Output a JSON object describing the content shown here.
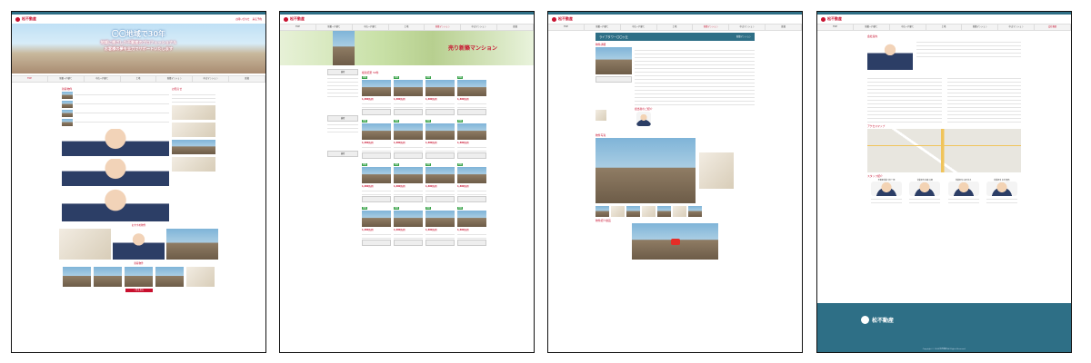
{
  "header": {
    "logo": "松不動産",
    "links": [
      "お問い合わせ",
      "来店予約",
      "会社概要"
    ]
  },
  "nav": [
    "TOP",
    "新築一戸建て",
    "中古一戸建て",
    "土地",
    "新築マンション",
    "中古マンション",
    "賃貸",
    "会社概要"
  ],
  "page1": {
    "hero_title": "〇〇地域で30年",
    "hero_line1": "地域に根ざした不動産のプロフェッショナル",
    "hero_line2": "お客様の夢を全力でサポートいたします",
    "section_new": "新着物件",
    "section_pickup": "おすすめ物件",
    "section_info": "お知らせ",
    "more": "一覧を見る"
  },
  "page2": {
    "hero_title": "売り新築マンション",
    "count_label": "検索結果 59件",
    "search_button": "検索",
    "listing_tag": "新築",
    "listing_price": "1,480万円"
  },
  "page3": {
    "title": "ライブタワー〇〇ヶ丘",
    "subtitle": "新築マンション",
    "section_detail": "物件詳細",
    "section_photo": "物件写真",
    "section_video": "物件紹介動画",
    "section_staff": "担当者のご紹介",
    "youtube": "▶"
  },
  "page4": {
    "company_title": "会社案内",
    "access_title": "アクセスマップ",
    "staff_title": "スタッフ紹介",
    "staff_names": [
      "不動産営業 中村一郎",
      "営業担当 佐藤 太郎",
      "営業担当 山田 花子",
      "営業担当 木村 優奈"
    ],
    "footer_brand": "松不動産",
    "copyright": "Copyright © 2024 松不動産 All Rights Reserved."
  }
}
